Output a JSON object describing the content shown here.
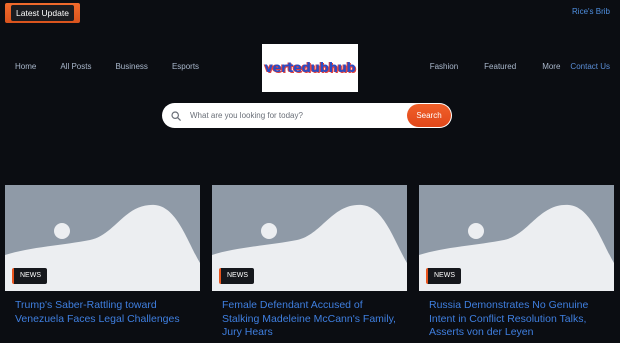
{
  "topbar": {
    "latest_label": "Latest Update",
    "ticker_text": "Rice's Brib"
  },
  "nav": {
    "left": [
      "Home",
      "All Posts",
      "Business",
      "Esports"
    ],
    "right": [
      "Fashion",
      "Featured",
      "More"
    ],
    "contact": "Contact Us"
  },
  "logo": {
    "text": "vertedubhub"
  },
  "search": {
    "placeholder": "What are you looking for today?",
    "button_label": "Search"
  },
  "cards": [
    {
      "badge": "NEWS",
      "title": "Trump's Saber-Rattling toward Venezuela Faces Legal Challenges"
    },
    {
      "badge": "NEWS",
      "title": "Female Defendant Accused of Stalking Madeleine McCann's Family, Jury Hears"
    },
    {
      "badge": "NEWS",
      "title": "Russia Demonstrates No Genuine Intent in Conflict Resolution Talks, Asserts von der Leyen"
    }
  ],
  "colors": {
    "accent": "#e9551f",
    "link": "#3f7fe0",
    "background": "#0b0d12"
  }
}
